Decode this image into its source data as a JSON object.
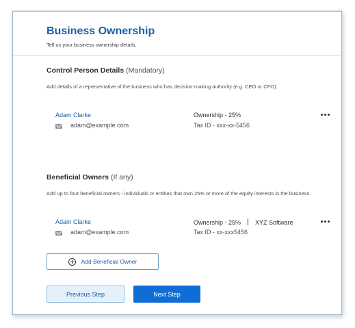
{
  "header": {
    "title": "Business Ownership",
    "subtitle": "Tell us your business ownership details."
  },
  "control_person": {
    "title": "Control Person Details",
    "qualifier": "(Mandatory)",
    "description": "Add details of a representative of the business who has decision-making authority (e.g. CEO or CFO).",
    "person": {
      "name": "Adam Clarke",
      "email": "adam@example.com",
      "ownership": "Ownership - 25%",
      "tax_id": "Tax ID - xxx-xx-5456"
    }
  },
  "beneficial_owners": {
    "title": "Beneficial Owners",
    "qualifier": "(If any)",
    "description": "Add up to four beneficial owners - individuals or entities that own 25% or more of the equity interests in the business.",
    "owners": [
      {
        "name": "Adam Clarke",
        "email": "adam@example.com",
        "ownership": "Ownership - 25%",
        "company": "XYZ Software",
        "tax_id": "Tax ID - xx-xxx5456"
      }
    ],
    "add_label": "Add Beneficial Owner"
  },
  "footer": {
    "previous_label": "Previous Step",
    "next_label": "Next Step"
  },
  "colors": {
    "accent": "#1a5fa8",
    "primary_button": "#0f6ed6",
    "secondary_button_bg": "#e4f1fb"
  },
  "icons": [
    "mail-icon",
    "more-options-icon",
    "plus-circle-icon"
  ]
}
